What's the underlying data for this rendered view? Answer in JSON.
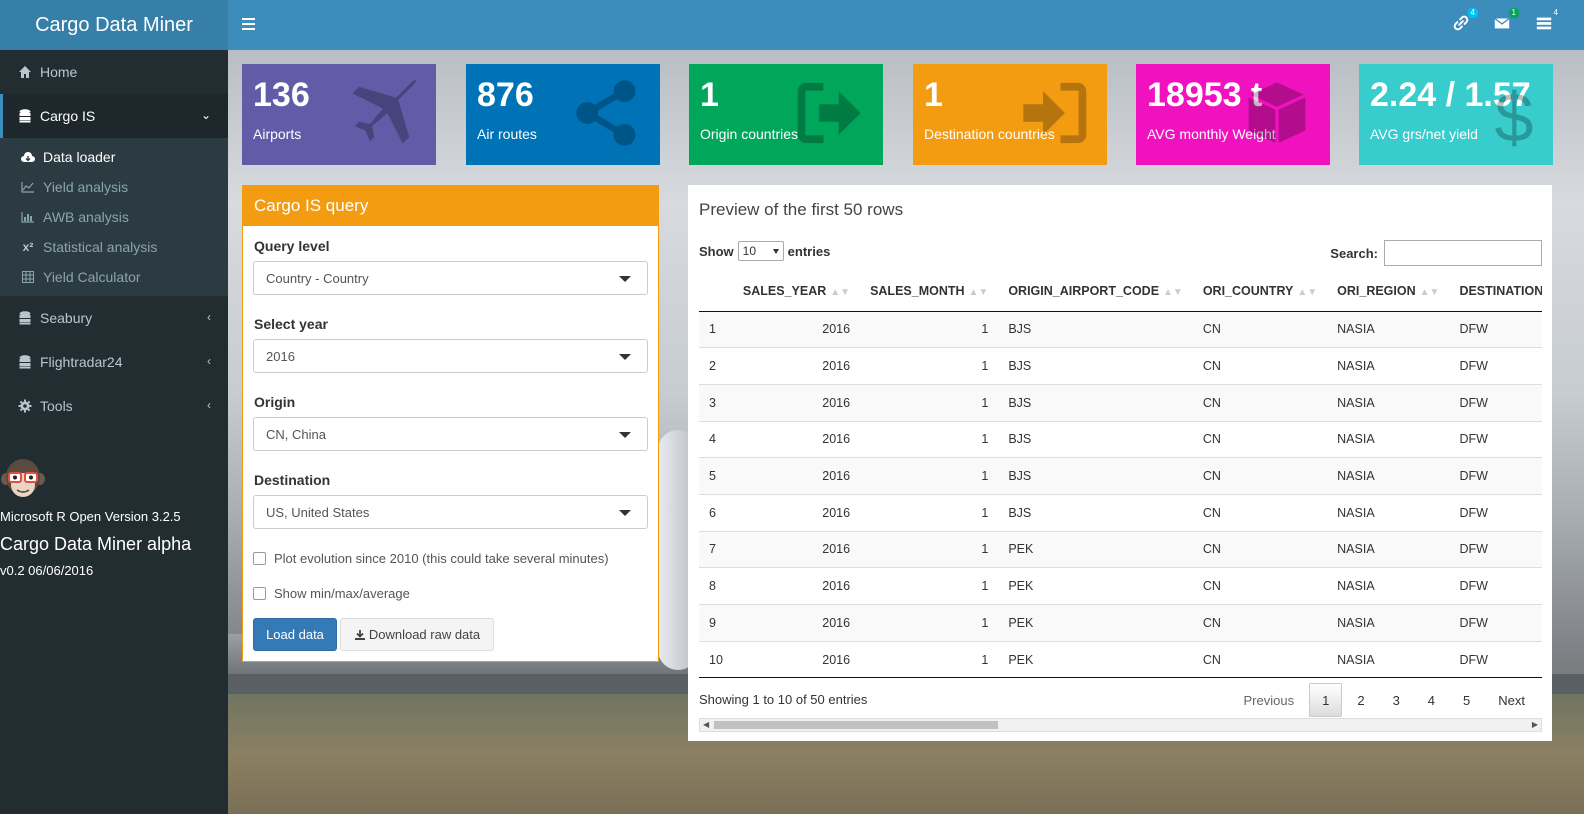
{
  "app": {
    "title": "Cargo Data Miner"
  },
  "header": {
    "icons": [
      {
        "name": "link-icon",
        "badge": "4",
        "badge_color": "#00c0ef"
      },
      {
        "name": "envelope-icon",
        "badge": "1",
        "badge_color": "#00a65a"
      },
      {
        "name": "tasks-icon",
        "badge": "4",
        "badge_color": "#3c8dbc"
      }
    ]
  },
  "sidebar": {
    "items": [
      {
        "label": "Home",
        "icon": "home-icon"
      },
      {
        "label": "Cargo IS",
        "icon": "database-icon"
      },
      {
        "label": "Seabury",
        "icon": "database-icon"
      },
      {
        "label": "Flightradar24",
        "icon": "database-icon"
      },
      {
        "label": "Tools",
        "icon": "gear-icon"
      }
    ],
    "subitems": [
      {
        "label": "Data loader",
        "icon": "cloud-download-icon"
      },
      {
        "label": "Yield analysis",
        "icon": "line-chart-icon"
      },
      {
        "label": "AWB analysis",
        "icon": "bar-chart-icon"
      },
      {
        "label": "Statistical analysis",
        "icon": "superscript-icon"
      },
      {
        "label": "Yield Calculator",
        "icon": "calculator-icon"
      }
    ],
    "footer": {
      "r_version": "Microsoft R Open Version 3.2.5",
      "app_version": "Cargo Data Miner alpha",
      "date": "v0.2 06/06/2016"
    }
  },
  "info_boxes": [
    {
      "value": "136",
      "label": "Airports",
      "color": "#605ca8",
      "icon": "plane-icon"
    },
    {
      "value": "876",
      "label": "Air routes",
      "color": "#0073b7",
      "icon": "share-icon"
    },
    {
      "value": "1",
      "label": "Origin countries",
      "color": "#00a65a",
      "icon": "sign-out-icon"
    },
    {
      "value": "1",
      "label": "Destination countries",
      "color": "#f39c12",
      "icon": "sign-in-icon"
    },
    {
      "value": "18953 t",
      "label": "AVG monthly Weight",
      "color": "#f012be",
      "icon": "cube-icon"
    },
    {
      "value": "2.24 / 1.57",
      "label": "AVG grs/net yield",
      "color": "#39cccc",
      "icon": "dollar-icon"
    }
  ],
  "query": {
    "title": "Cargo IS query",
    "fields": [
      {
        "label": "Query level",
        "value": "Country - Country"
      },
      {
        "label": "Select year",
        "value": "2016"
      },
      {
        "label": "Origin",
        "value": "CN, China"
      },
      {
        "label": "Destination",
        "value": "US, United States"
      }
    ],
    "checkboxes": [
      "Plot evolution since 2010 (this could take several minutes)",
      "Show min/max/average"
    ],
    "load_label": "Load data",
    "download_label": "Download raw data"
  },
  "table": {
    "title": "Preview of the first 50 rows",
    "show_label": "Show",
    "entries_label": "entries",
    "length_value": "10",
    "search_label": "Search:",
    "columns": [
      "",
      "SALES_YEAR",
      "SALES_MONTH",
      "ORIGIN_AIRPORT_CODE",
      "ORI_COUNTRY",
      "ORI_REGION",
      "DESTINATION_AIRPOI"
    ],
    "rows": [
      [
        "1",
        "2016",
        "1",
        "BJS",
        "CN",
        "NASIA",
        "DFW"
      ],
      [
        "2",
        "2016",
        "1",
        "BJS",
        "CN",
        "NASIA",
        "DFW"
      ],
      [
        "3",
        "2016",
        "1",
        "BJS",
        "CN",
        "NASIA",
        "DFW"
      ],
      [
        "4",
        "2016",
        "1",
        "BJS",
        "CN",
        "NASIA",
        "DFW"
      ],
      [
        "5",
        "2016",
        "1",
        "BJS",
        "CN",
        "NASIA",
        "DFW"
      ],
      [
        "6",
        "2016",
        "1",
        "BJS",
        "CN",
        "NASIA",
        "DFW"
      ],
      [
        "7",
        "2016",
        "1",
        "PEK",
        "CN",
        "NASIA",
        "DFW"
      ],
      [
        "8",
        "2016",
        "1",
        "PEK",
        "CN",
        "NASIA",
        "DFW"
      ],
      [
        "9",
        "2016",
        "1",
        "PEK",
        "CN",
        "NASIA",
        "DFW"
      ],
      [
        "10",
        "2016",
        "1",
        "PEK",
        "CN",
        "NASIA",
        "DFW"
      ]
    ],
    "info": "Showing 1 to 10 of 50 entries",
    "pager": {
      "previous": "Previous",
      "pages": [
        "1",
        "2",
        "3",
        "4",
        "5"
      ],
      "next": "Next"
    }
  }
}
